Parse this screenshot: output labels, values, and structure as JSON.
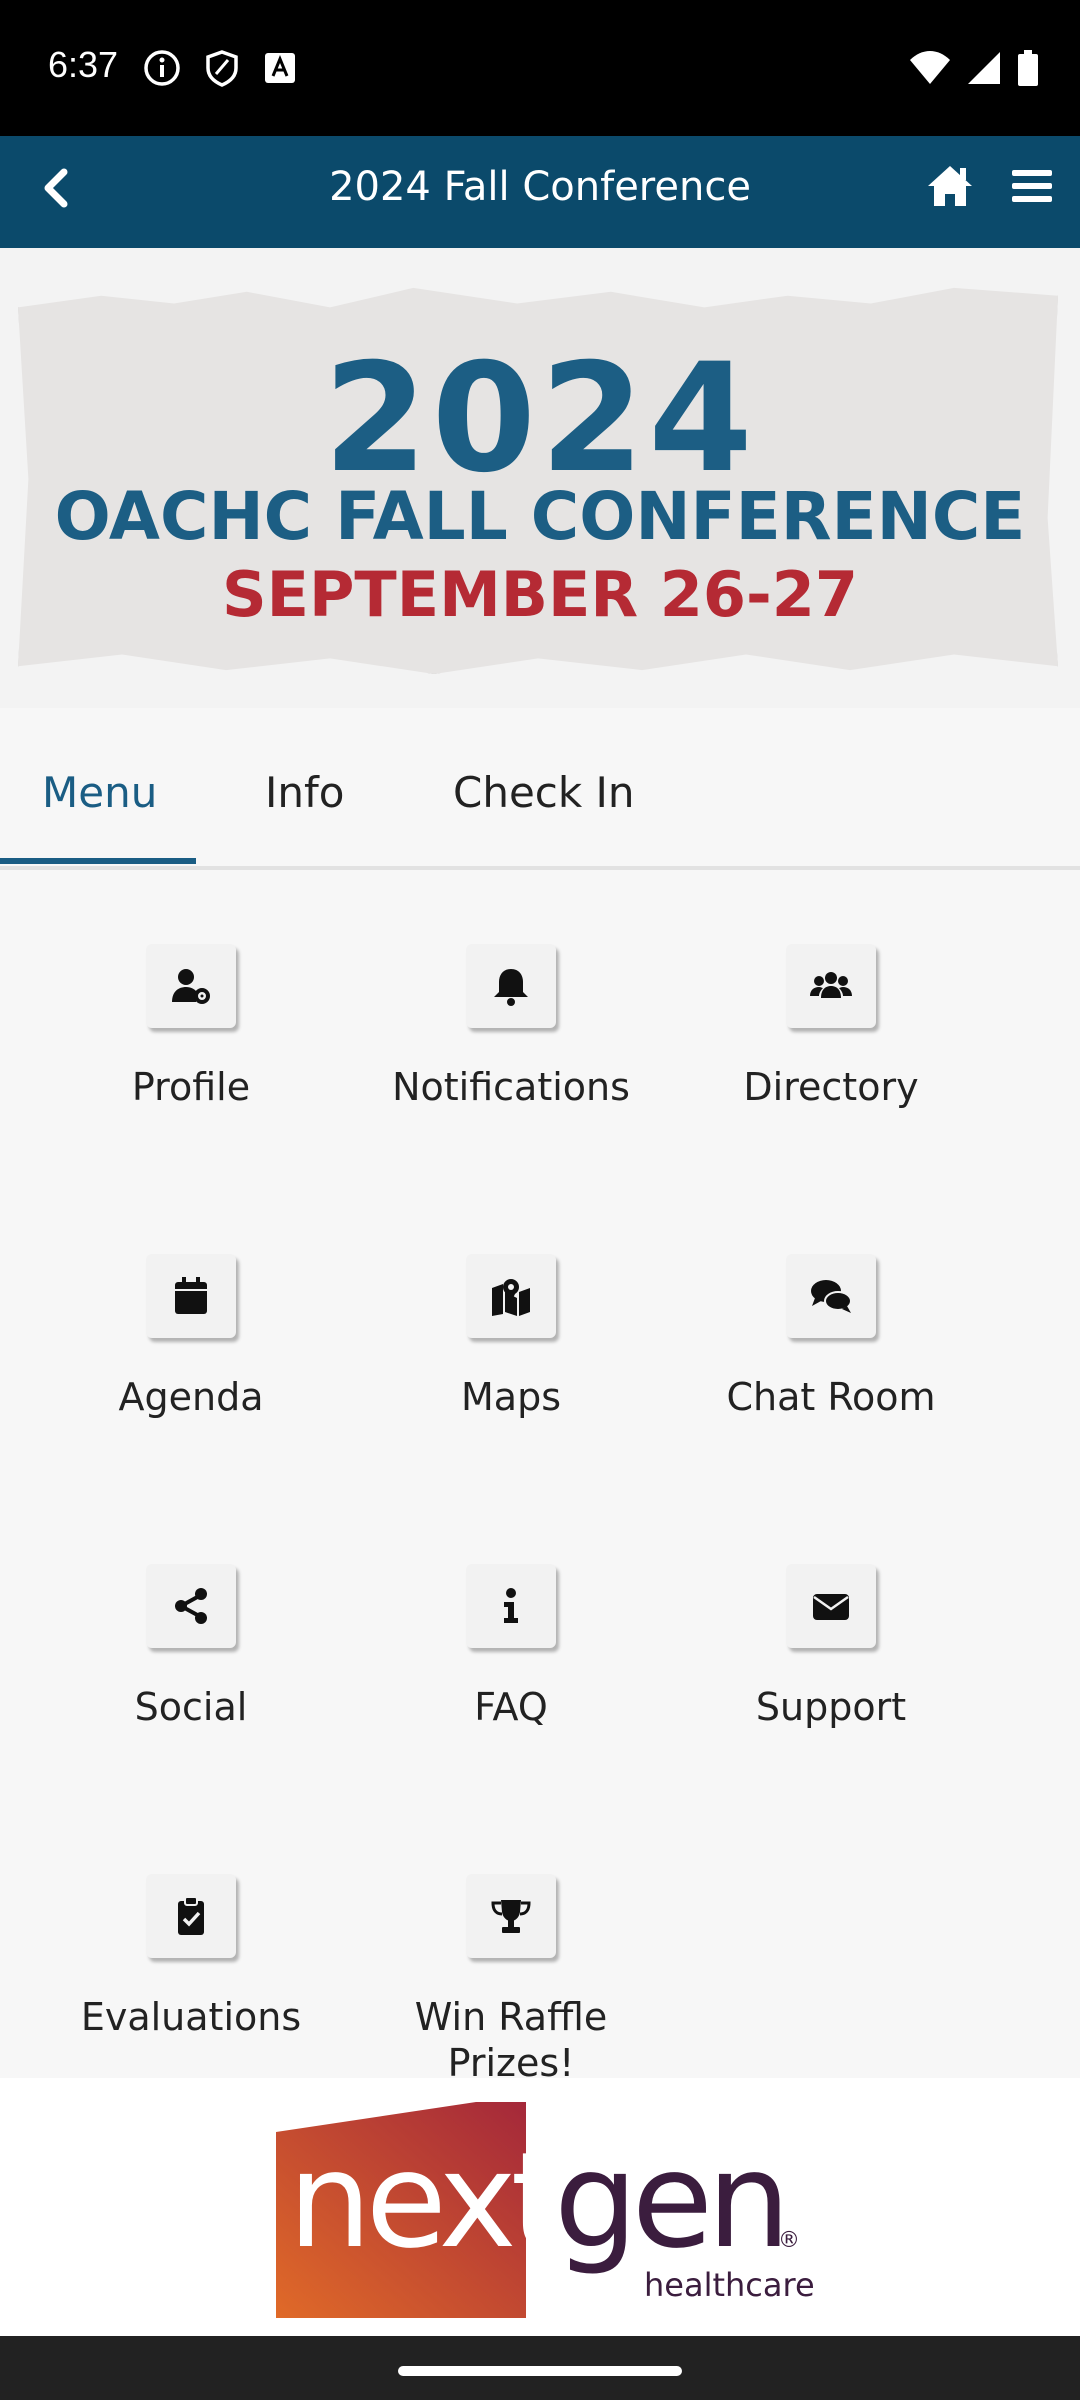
{
  "status_bar": {
    "time": "6:37",
    "left_icons": [
      "info-icon",
      "shield-icon",
      "font-icon"
    ],
    "right_icons": [
      "wifi-icon",
      "signal-icon",
      "battery-icon"
    ]
  },
  "app_bar": {
    "title": "2024 Fall Conference",
    "back_icon": "back-chevron-icon",
    "home_icon": "home-icon",
    "menu_icon": "hamburger-menu-icon"
  },
  "banner": {
    "year": "2024",
    "line2": "OACHC FALL CONFERENCE",
    "line3": "SEPTEMBER 26-27",
    "colors": {
      "blue": "#1c5e84",
      "red": "#b52a34"
    }
  },
  "tabs": [
    {
      "label": "Menu",
      "active": true
    },
    {
      "label": "Info",
      "active": false
    },
    {
      "label": "Check In",
      "active": false
    }
  ],
  "menu_items": [
    {
      "label": "Profile",
      "icon": "user-gear-icon"
    },
    {
      "label": "Notifications",
      "icon": "bell-icon"
    },
    {
      "label": "Directory",
      "icon": "users-icon"
    },
    {
      "label": "Agenda",
      "icon": "calendar-icon"
    },
    {
      "label": "Maps",
      "icon": "map-location-icon"
    },
    {
      "label": "Chat Room",
      "icon": "chat-bubbles-icon"
    },
    {
      "label": "Social",
      "icon": "share-icon"
    },
    {
      "label": "FAQ",
      "icon": "info-icon"
    },
    {
      "label": "Support",
      "icon": "envelope-icon"
    },
    {
      "label": "Evaluations",
      "icon": "clipboard-check-icon"
    },
    {
      "label": "Win Raffle Prizes!",
      "icon": "trophy-icon"
    }
  ],
  "footer": {
    "logo_word": "nextgen",
    "logo_sub": "healthcare",
    "logo_mark": "®"
  },
  "theme": {
    "app_bar_color": "#0b4a6b",
    "accent": "#1a5d84"
  }
}
